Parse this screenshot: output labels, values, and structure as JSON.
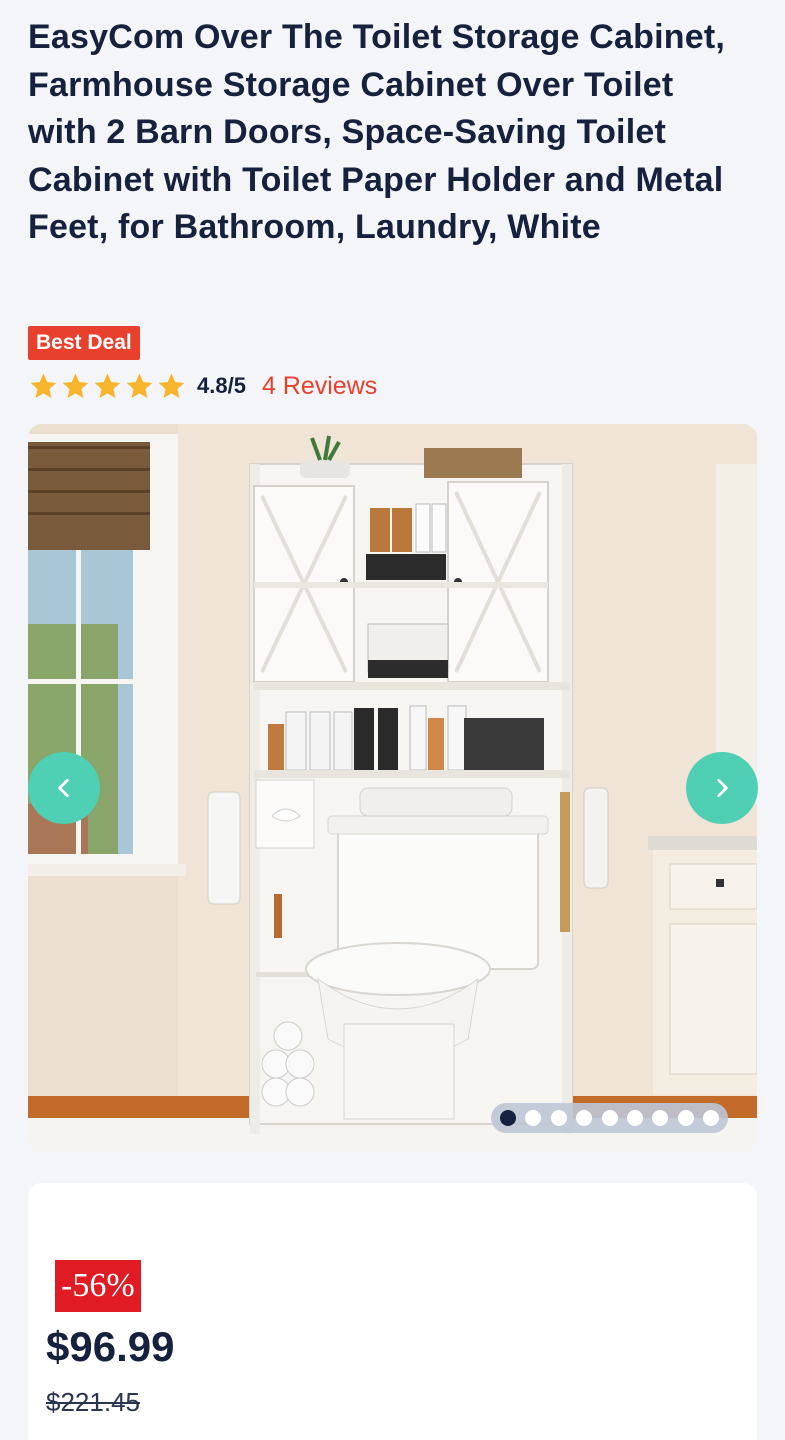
{
  "product": {
    "title": "EasyCom Over The Toilet Storage Cabinet, Farmhouse Storage Cabinet Over Toilet with 2 Barn Doors, Space-Saving Toilet Cabinet with Toilet Paper Holder and Metal Feet, for Bathroom, Laundry, White",
    "badge": "Best Deal"
  },
  "rating": {
    "value": "4.8/5",
    "stars": 5,
    "star_icon": "star-icon",
    "reviews_label": "4 Reviews"
  },
  "gallery": {
    "image_name": "over-toilet-storage-cabinet-photo",
    "prev_icon": "chevron-left-icon",
    "next_icon": "chevron-right-icon",
    "image_count": 9,
    "active_index": 0
  },
  "pricing": {
    "discount": "-56%",
    "price": "$96.99",
    "original_price": "$221.45"
  },
  "colors": {
    "accent_red": "#e8402c",
    "discount_red": "#e01b24",
    "star": "#f7b42c",
    "nav_button": "#4fcfb3",
    "text": "#16213d"
  }
}
